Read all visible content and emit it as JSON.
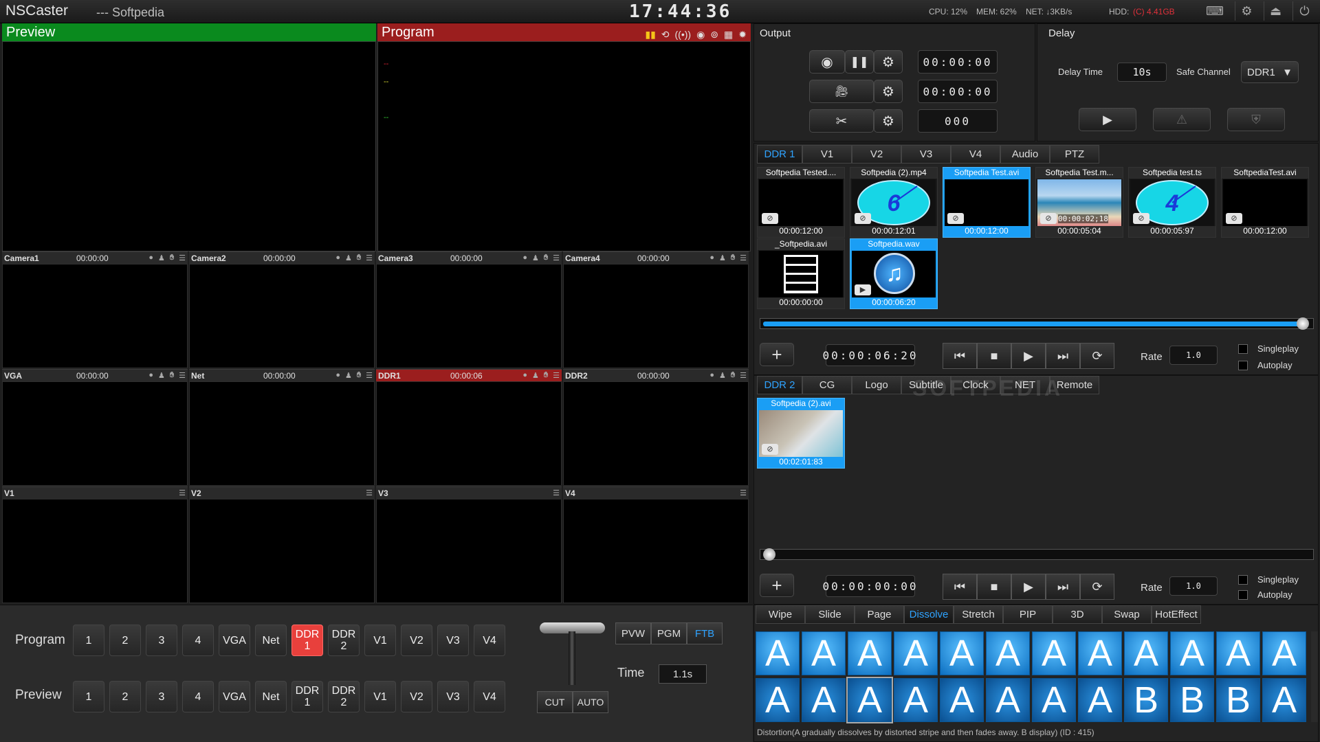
{
  "app": {
    "name": "NSCaster",
    "subtitle": "--- Softpedia",
    "clock": "17:44:36"
  },
  "stats": {
    "cpu": "CPU: 12%",
    "mem": "MEM: 62%",
    "net": "NET:  ↓3KB/s",
    "hdd_label": "HDD:",
    "hdd_value": "(C) 4.41GB"
  },
  "preview": {
    "title": "Preview"
  },
  "program": {
    "title": "Program",
    "overlay": [
      "--",
      "--",
      "--"
    ]
  },
  "monitors": [
    {
      "name": "Camera1",
      "tc": "00:00:00"
    },
    {
      "name": "Camera2",
      "tc": "00:00:00"
    },
    {
      "name": "Camera3",
      "tc": "00:00:00"
    },
    {
      "name": "Camera4",
      "tc": "00:00:00"
    },
    {
      "name": "VGA",
      "tc": "00:00:00"
    },
    {
      "name": "Net",
      "tc": "00:00:00"
    },
    {
      "name": "DDR1",
      "tc": "00:00:06"
    },
    {
      "name": "DDR2",
      "tc": "00:00:00"
    },
    {
      "name": "V1",
      "tc": ""
    },
    {
      "name": "V2",
      "tc": ""
    },
    {
      "name": "V3",
      "tc": ""
    },
    {
      "name": "V4",
      "tc": ""
    }
  ],
  "switcher": {
    "program_label": "Program",
    "preview_label": "Preview",
    "buttons": [
      "1",
      "2",
      "3",
      "4",
      "VGA",
      "Net",
      "DDR 1",
      "DDR 2",
      "V1",
      "V2",
      "V3",
      "V4"
    ],
    "program_active": "DDR 1",
    "modes": [
      "PVW",
      "PGM",
      "FTB"
    ],
    "time_label": "Time",
    "time_value": "1.1s",
    "cut": "CUT",
    "auto": "AUTO"
  },
  "output": {
    "title": "Output",
    "record_tc": "00:00:00",
    "stream_tc": "00:00:00",
    "clip_count": "000"
  },
  "delay": {
    "title": "Delay",
    "delay_time_label": "Delay Time",
    "delay_time_value": "10s",
    "safe_channel_label": "Safe Channel",
    "safe_channel_value": "DDR1"
  },
  "ddr1": {
    "tabs": [
      "DDR 1",
      "V1",
      "V2",
      "V3",
      "V4",
      "Audio",
      "PTZ"
    ],
    "clips": [
      {
        "name": "Softpedia Tested....",
        "dur": "00:00:12:00",
        "thumb": "black",
        "sel": false
      },
      {
        "name": "Softpedia (2).mp4",
        "dur": "00:00:12:01",
        "thumb": "clock6",
        "sel": false
      },
      {
        "name": "Softpedia Test.avi",
        "dur": "00:00:12:00",
        "thumb": "black",
        "sel": true
      },
      {
        "name": "Softpedia Test.m...",
        "dur": "00:00:05:04",
        "thumb": "beach",
        "sel": false
      },
      {
        "name": "Softpedia test.ts",
        "dur": "00:00:05:97",
        "thumb": "clock4",
        "sel": false
      },
      {
        "name": "SoftpediaTest.avi",
        "dur": "00:00:12:00",
        "thumb": "black",
        "sel": false
      },
      {
        "name": "_Softpedia.avi",
        "dur": "00:00:00:00",
        "thumb": "film",
        "sel": false
      },
      {
        "name": "Softpedia.wav",
        "dur": "00:00:06:20",
        "thumb": "music",
        "sel": true
      }
    ],
    "beach_tc": "00:00:02;18",
    "timecode": "00:00:06:20",
    "rate_label": "Rate",
    "rate": "1.0",
    "single": "Singleplay",
    "auto": "Autoplay"
  },
  "ddr2": {
    "tabs": [
      "DDR 2",
      "CG",
      "Logo",
      "Subtitle",
      "Clock",
      "NET",
      "Remote"
    ],
    "clip": {
      "name": "Softpedia (2).avi",
      "dur": "00:02:01:83"
    },
    "timecode": "00:00:00:00",
    "rate_label": "Rate",
    "rate": "1.0",
    "single": "Singleplay",
    "auto": "Autoplay"
  },
  "effects": {
    "tabs": [
      "Wipe",
      "Slide",
      "Page",
      "Dissolve",
      "Stretch",
      "PIP",
      "3D",
      "Swap",
      "HotEffect"
    ],
    "active": "Dissolve",
    "tiles": [
      "A",
      "A",
      "A",
      "A",
      "A",
      "A",
      "A",
      "A",
      "A",
      "A",
      "A",
      "A",
      "A",
      "A",
      "A",
      "A",
      "A",
      "A",
      "A",
      "A",
      "B",
      "B",
      "B",
      "A"
    ],
    "description": "Distortion(A gradually dissolves by distorted stripe and then fades away. B display) (ID : 415)"
  },
  "watermark": "SOFTPEDIA",
  "colors": {
    "preview_green": "#0a8a1e",
    "program_red": "#9b1e1e",
    "accent_blue": "#1a9ef5",
    "active_red": "#e8403c"
  }
}
